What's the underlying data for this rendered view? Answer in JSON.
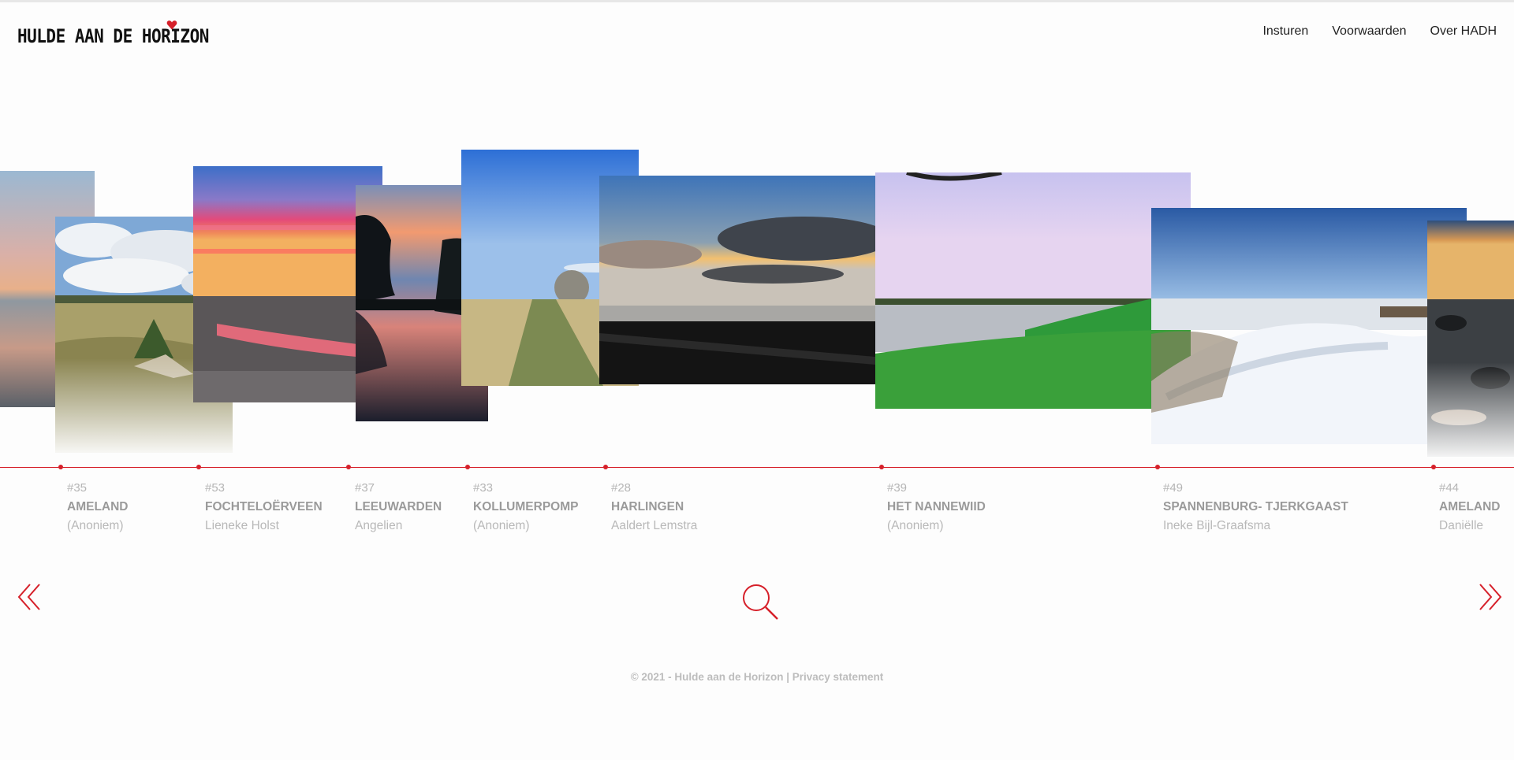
{
  "header": {
    "logo_text": "HULDE AAN DE HORIZON",
    "nav": [
      "Insturen",
      "Voorwaarden",
      "Over HADH"
    ]
  },
  "accent_color": "#d6202a",
  "entries": [
    {
      "number": "#35",
      "place": "AMELAND",
      "author": "(Anoniem)"
    },
    {
      "number": "#53",
      "place": "FOCHTELOËRVEEN",
      "author": "Lieneke Holst"
    },
    {
      "number": "#37",
      "place": "LEEUWARDEN",
      "author": "Angelien"
    },
    {
      "number": "#33",
      "place": "KOLLUMERPOMP",
      "author": "(Anoniem)"
    },
    {
      "number": "#28",
      "place": "HARLINGEN",
      "author": "Aaldert Lemstra"
    },
    {
      "number": "#39",
      "place": "HET NANNEWIID",
      "author": "(Anoniem)"
    },
    {
      "number": "#49",
      "place": "SPANNENBURG- TJERKGAAST",
      "author": "Ineke Bijl-Graafsma"
    },
    {
      "number": "#44",
      "place": "AMELAND",
      "author": "Daniëlle"
    }
  ],
  "controls": {
    "prev_icon": "double-chevron-left-icon",
    "search_icon": "search-icon",
    "next_icon": "double-chevron-right-icon"
  },
  "footer": {
    "copyright": "© 2021 - Hulde aan de Horizon | ",
    "privacy_link": "Privacy statement"
  }
}
